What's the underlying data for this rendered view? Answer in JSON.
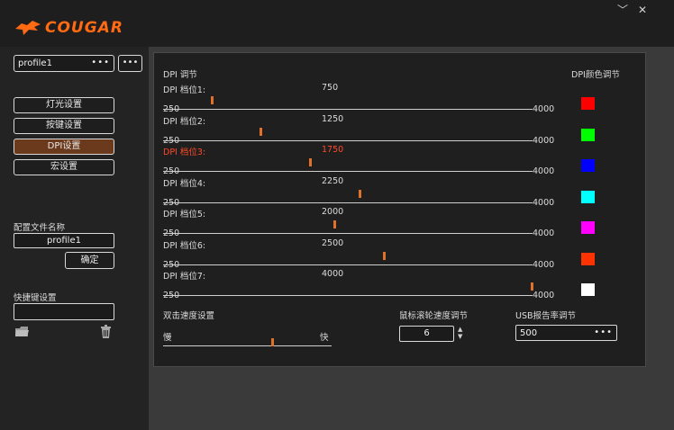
{
  "app": {
    "logo_text": "COUGAR"
  },
  "window": {
    "minimize_glyph": "﹀",
    "close_glyph": "✕"
  },
  "sidebar": {
    "profile_value": "profile1",
    "profile_dots": "•••",
    "more_dots": "•••",
    "nav": [
      {
        "label": "灯光设置"
      },
      {
        "label": "按键设置"
      },
      {
        "label": "DPI设置",
        "active": true
      },
      {
        "label": "宏设置"
      }
    ],
    "config_name_label": "配置文件名称",
    "config_name_value": "profile1",
    "confirm_label": "确定",
    "shortcut_label": "快捷键设置",
    "shortcut_value": "",
    "folder_icon": "folder-icon",
    "trash_icon": "trash-icon"
  },
  "dpi": {
    "title": "DPI 调节",
    "color_title": "DPI颜色调节",
    "min_label": "250",
    "max_label": "4000",
    "levels": [
      {
        "label": "DPI 档位1:",
        "value": "750",
        "fraction": 0.133,
        "color": "#ff0000",
        "active": false
      },
      {
        "label": "DPI 档位2:",
        "value": "1250",
        "fraction": 0.267,
        "color": "#00ff00",
        "active": false
      },
      {
        "label": "DPI 档位3:",
        "value": "1750",
        "fraction": 0.4,
        "color": "#0000ff",
        "active": true
      },
      {
        "label": "DPI 档位4:",
        "value": "2250",
        "fraction": 0.533,
        "color": "#00ffff",
        "active": false
      },
      {
        "label": "DPI 档位5:",
        "value": "2000",
        "fraction": 0.467,
        "color": "#ff00ff",
        "active": false
      },
      {
        "label": "DPI 档位6:",
        "value": "2500",
        "fraction": 0.6,
        "color": "#ff3300",
        "active": false
      },
      {
        "label": "DPI 档位7:",
        "value": "4000",
        "fraction": 1.0,
        "color": "#ffffff",
        "active": false
      }
    ]
  },
  "double_click": {
    "label": "双击速度设置",
    "slow_label": "慢",
    "fast_label": "快",
    "fraction": 0.65
  },
  "scroll": {
    "label": "鼠标滚轮速度调节",
    "value": "6",
    "up_glyph": "▲",
    "down_glyph": "▼"
  },
  "usb": {
    "label": "USB报告率调节",
    "value": "500",
    "dots": "•••"
  },
  "colors": {
    "accent": "#e0712a",
    "active_red": "#ff4a2a"
  }
}
